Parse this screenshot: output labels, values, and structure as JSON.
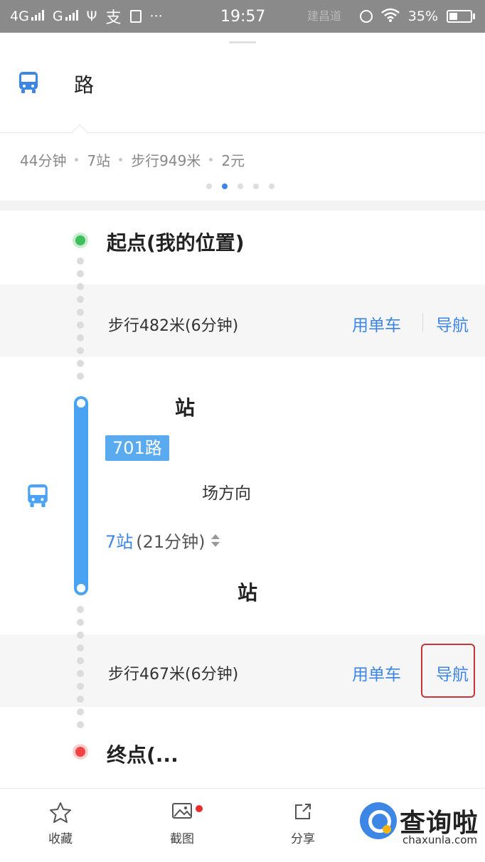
{
  "status_bar": {
    "carrier1": "4G",
    "carrier2": "G",
    "time": "19:57",
    "watermark": "建昌道",
    "battery": "35%"
  },
  "route": {
    "name": "路"
  },
  "summary": {
    "duration": "44分钟",
    "stops": "7站",
    "walk": "步行949米",
    "price": "2元",
    "page_index": 2,
    "page_count": 5
  },
  "steps": {
    "start": "起点(我的位置)",
    "walk1": {
      "text": "步行482米(6分钟)",
      "bike": "用单车",
      "nav": "导航"
    },
    "board_station": "站",
    "line": "701路",
    "direction": "场方向",
    "ride": {
      "count": "7站",
      "duration": "(21分钟)"
    },
    "alight_station": "站",
    "walk2": {
      "text": "步行467米(6分钟)",
      "bike": "用单车",
      "nav": "导航"
    },
    "end": "终点(..."
  },
  "bottom_bar": {
    "favorite": "收藏",
    "screenshot": "截图",
    "share": "分享"
  },
  "watermark_logo": {
    "title": "查询啦",
    "url": "chaxunla.com"
  },
  "colors": {
    "accent": "#3d86e6",
    "bus_line": "#4aa3f2",
    "start": "#3cbf5c",
    "end": "#f24444",
    "highlight_box": "#c9343a"
  }
}
